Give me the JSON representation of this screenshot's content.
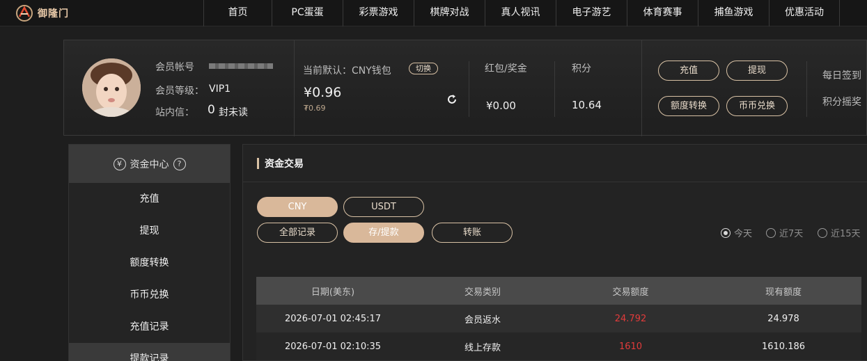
{
  "colors": {
    "accent": "#d9c2a5",
    "accent_fill": "#d9b89a",
    "negative": "#e23b3b",
    "background": "#1e1e1e"
  },
  "logo": {
    "text": "御隆门",
    "icon": "dragon-logo-icon"
  },
  "nav": {
    "items": [
      "首页",
      "PC蛋蛋",
      "彩票游戏",
      "棋牌对战",
      "真人视讯",
      "电子游艺",
      "体育赛事",
      "捕鱼游戏",
      "优惠活动"
    ]
  },
  "member": {
    "account_label": "会员帐号",
    "level_label": "会员等级：",
    "level_value": "VIP1",
    "mail_label": "站内信：",
    "mail_count": "0",
    "mail_unread": "封未读",
    "wallet_label": "当前默认：CNY钱包",
    "switch_label": "切换",
    "balance_main": "¥0.96",
    "balance_sub": "₮0.69",
    "bonus_label": "红包/奖金",
    "bonus_value": "¥0.00",
    "points_label": "积分",
    "points_value": "10.64",
    "actions": {
      "deposit": "充值",
      "withdraw": "提现",
      "transfer": "额度转换",
      "exchange": "币币兑换"
    },
    "daily_checkin": "每日签到",
    "points_lottery": "积分摇奖"
  },
  "sidebar": {
    "title": "资金中心",
    "items": [
      "充值",
      "提现",
      "额度转换",
      "币币兑换",
      "充值记录",
      "提款记录"
    ]
  },
  "main": {
    "title": "资金交易",
    "currency_tabs": [
      "CNY",
      "USDT"
    ],
    "record_tabs": [
      "全部记录",
      "存/提款",
      "转账"
    ],
    "range_options": [
      "今天",
      "近7天",
      "近15天"
    ],
    "selected_range": "今天",
    "table": {
      "headers": [
        "日期(美东)",
        "交易类别",
        "交易额度",
        "现有额度"
      ],
      "rows": [
        [
          "2026-07-01 02:45:17",
          "会员返水",
          "24.792",
          "24.978"
        ],
        [
          "2026-07-01 02:10:35",
          "线上存款",
          "1610",
          "1610.186"
        ]
      ]
    }
  }
}
